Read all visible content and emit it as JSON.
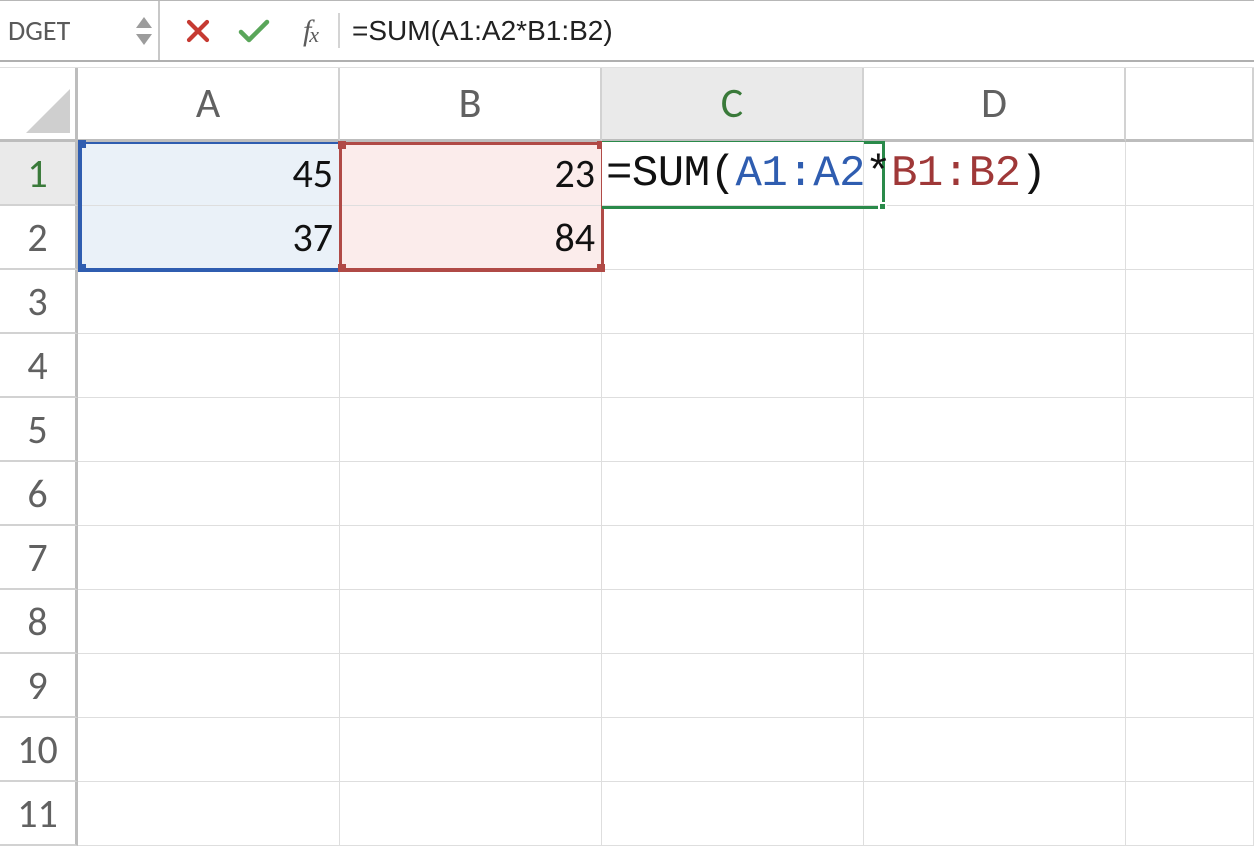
{
  "namebox": {
    "value": "DGET"
  },
  "toolbar": {
    "fx_label": "fx"
  },
  "formula_bar": {
    "raw": "=SUM(A1:A2*B1:B2)",
    "eq": "=",
    "fn": "SUM",
    "open": "(",
    "range1": "A1:A2",
    "op": "*",
    "range2": "B1:B2",
    "close": ")"
  },
  "columns": [
    "A",
    "B",
    "C",
    "D",
    ""
  ],
  "rows": [
    "1",
    "2",
    "3",
    "4",
    "5",
    "6",
    "7",
    "8",
    "9",
    "10",
    "11"
  ],
  "cells": {
    "A1": "45",
    "A2": "37",
    "B1": "23",
    "B2": "84"
  },
  "c1_formula": {
    "eq": "=",
    "fn": "SUM",
    "open": "(",
    "range1": "A1:A2",
    "op": "*",
    "range2": "B1:B2",
    "close": ")"
  },
  "colors": {
    "range_blue": "#2f5db0",
    "range_red": "#9f3838",
    "active_green": "#2a8a4a"
  }
}
